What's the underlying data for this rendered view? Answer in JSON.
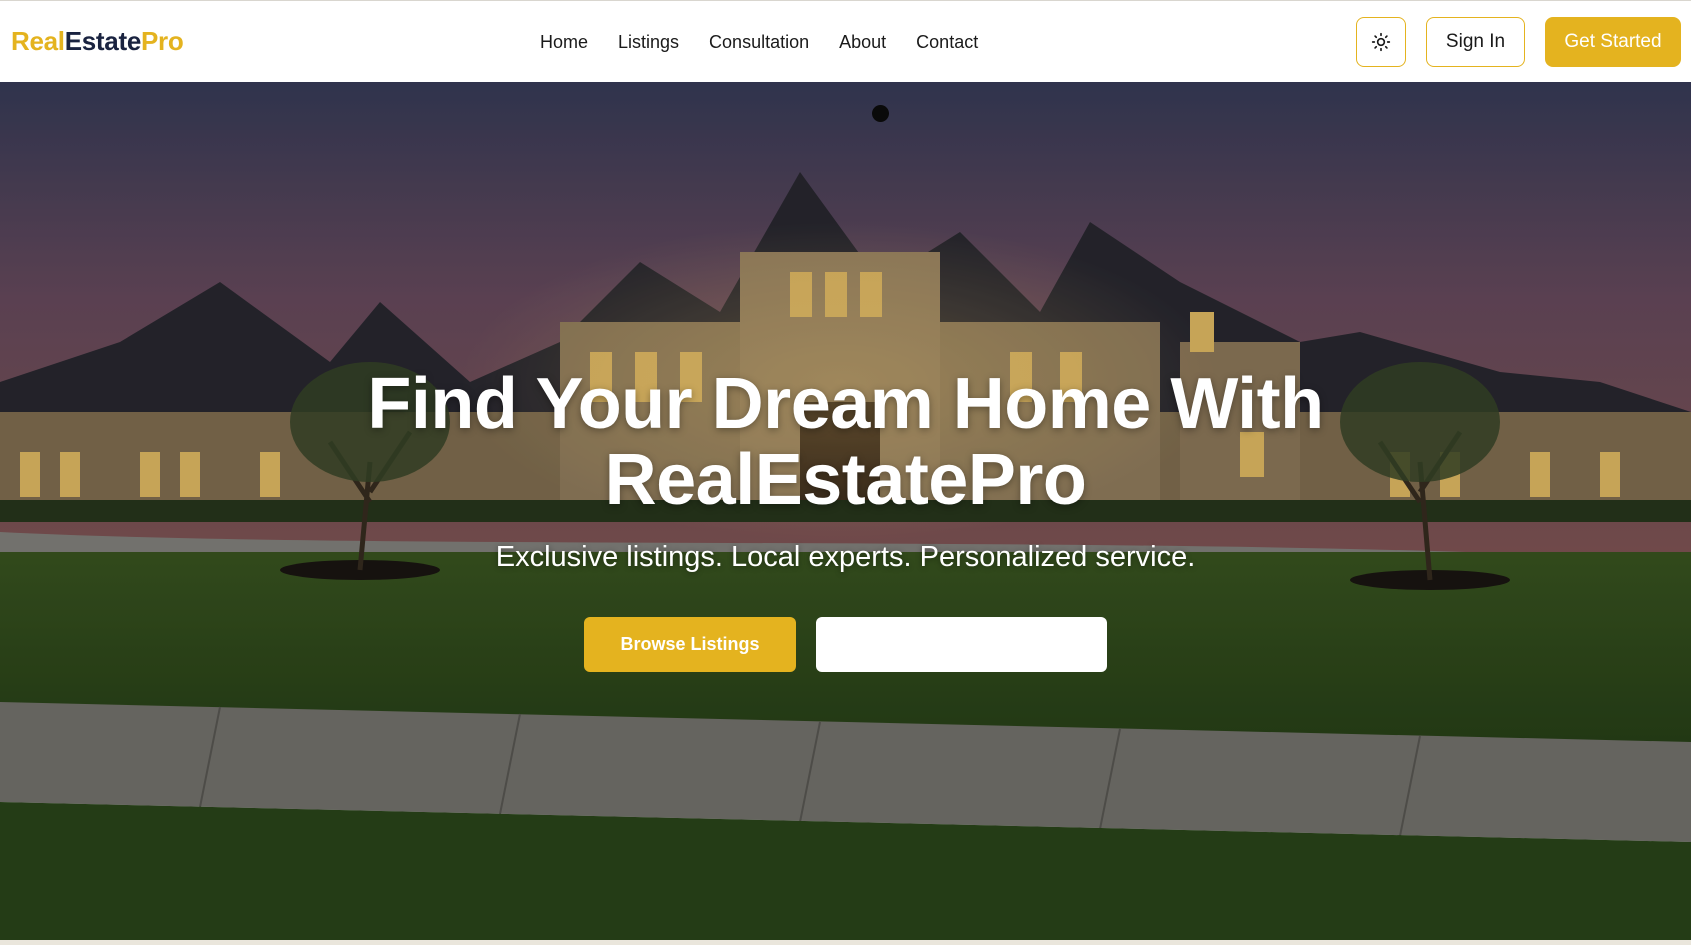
{
  "brand": {
    "part1": "Real",
    "part2": "Estate",
    "part3": "Pro"
  },
  "nav": {
    "items": [
      {
        "label": "Home"
      },
      {
        "label": "Listings"
      },
      {
        "label": "Consultation"
      },
      {
        "label": "About"
      },
      {
        "label": "Contact"
      }
    ]
  },
  "header_actions": {
    "theme_toggle_icon": "sun-icon",
    "sign_in_label": "Sign In",
    "get_started_label": "Get Started"
  },
  "hero": {
    "title_line1": "Find Your Dream Home With",
    "title_line2": "RealEstatePro",
    "subtitle": "Exclusive listings. Local experts. Personalized service.",
    "primary_button_label": "Browse Listings",
    "secondary_button_label": ""
  },
  "colors": {
    "accent": "#e4b31f",
    "brand_dark": "#1a2340",
    "text": "#1a1a1a",
    "white": "#ffffff"
  }
}
